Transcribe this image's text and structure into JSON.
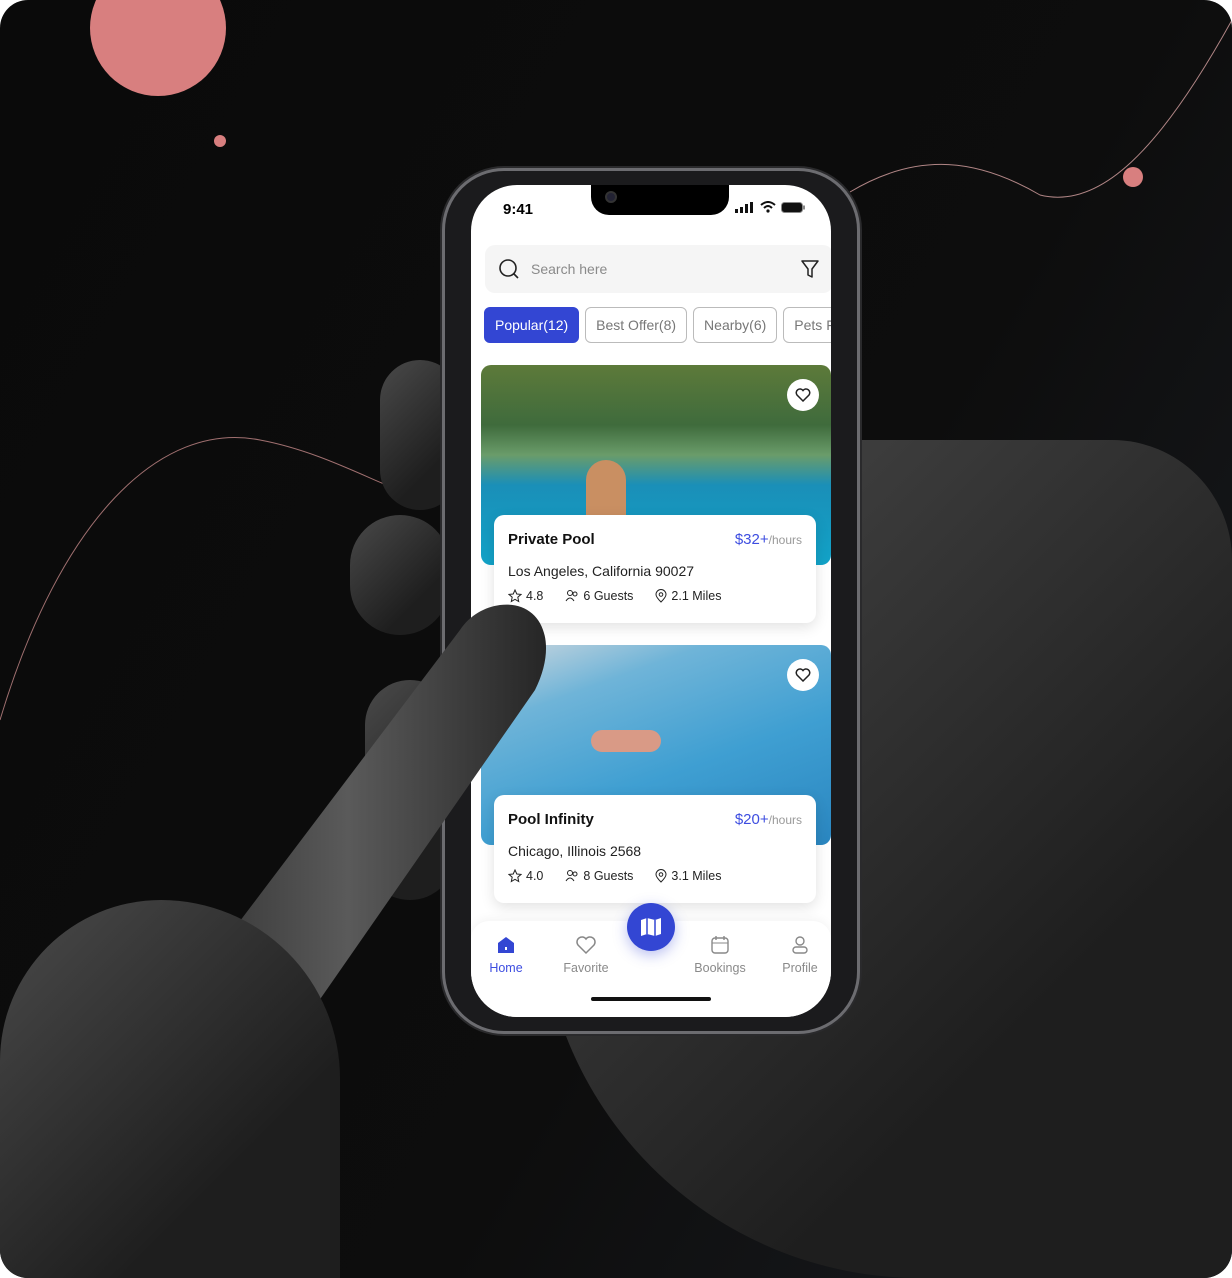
{
  "status_bar": {
    "time": "9:41"
  },
  "search": {
    "placeholder": "Search here"
  },
  "chips": [
    {
      "label": "Popular(12)",
      "active": true
    },
    {
      "label": "Best Offer(8)",
      "active": false
    },
    {
      "label": "Nearby(6)",
      "active": false
    },
    {
      "label": "Pets Frie",
      "active": false
    }
  ],
  "listings": [
    {
      "name": "Private Pool",
      "price": "$32+",
      "unit": "/hours",
      "address": "Los Angeles, California 90027",
      "rating": "4.8",
      "guests": "6 Guests",
      "distance": "2.1 Miles"
    },
    {
      "name": "Pool Infinity",
      "price": "$20+",
      "unit": "/hours",
      "address": "Chicago, Illinois 2568",
      "rating": "4.0",
      "guests": "8 Guests",
      "distance": "3.1 Miles"
    }
  ],
  "nav": {
    "home": "Home",
    "favorite": "Favorite",
    "bookings": "Bookings",
    "profile": "Profile"
  },
  "colors": {
    "accent": "#3346d3",
    "price": "#3d4de0",
    "decor": "#d87f7f"
  }
}
